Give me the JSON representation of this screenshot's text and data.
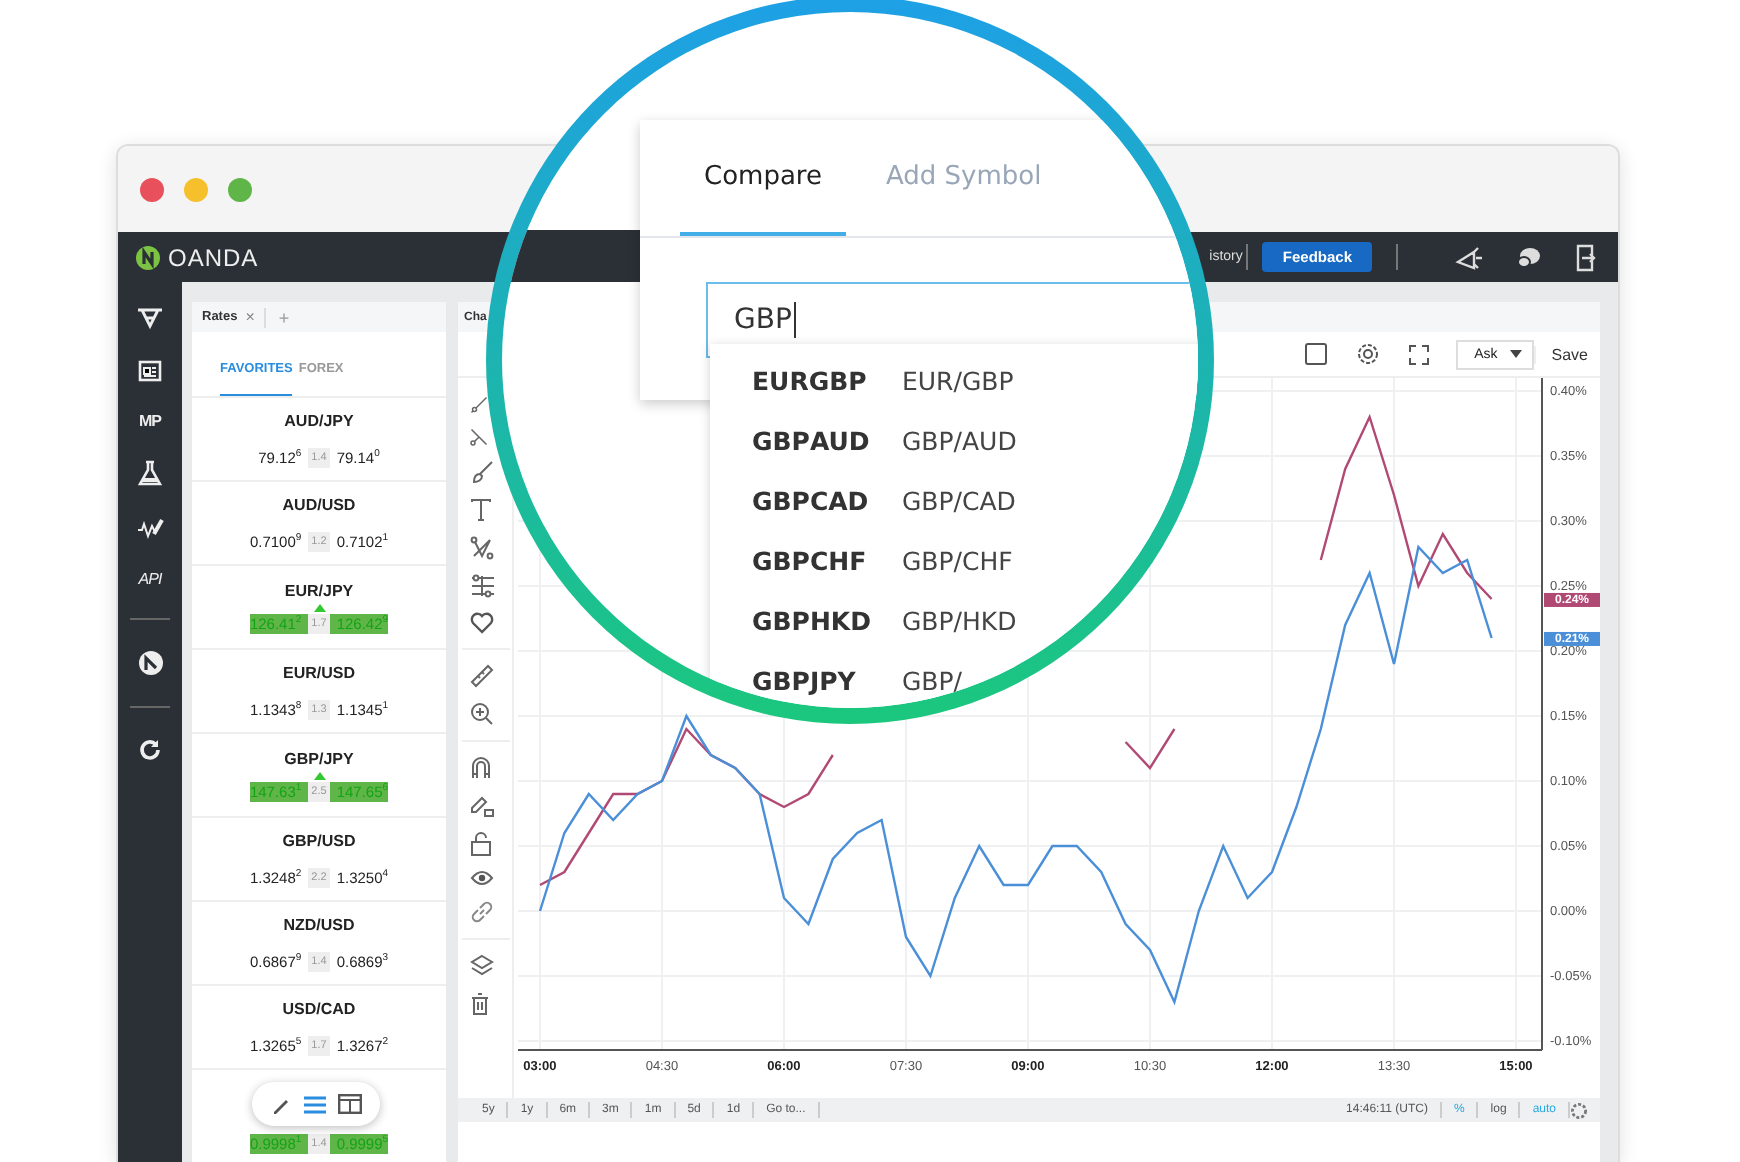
{
  "app_bar": {
    "logo": "OANDA",
    "link": "istory",
    "feedback": "Feedback"
  },
  "sidebar": {
    "labels": [
      "MP",
      "API"
    ]
  },
  "rates_panel": {
    "tab": "Rates",
    "close": "×",
    "add": "+",
    "filters": [
      {
        "label": "FAVORITES",
        "selected": true
      },
      {
        "label": "FOREX",
        "selected": false
      }
    ],
    "rows": [
      {
        "pair": "AUD/JPY",
        "up": false,
        "bid": "79.12$^{6}$",
        "spread": "1.4",
        "ask": "79.14$^{0}$"
      },
      {
        "pair": "AUD/USD",
        "up": false,
        "bid": "0.7100$^{9}$",
        "spread": "1.2",
        "ask": "0.7102$^{1}$"
      },
      {
        "pair": "EUR/JPY",
        "up": true,
        "bid": "126.41$^{2}$",
        "spread": "1.7",
        "ask": "126.42$^{9}$"
      },
      {
        "pair": "EUR/USD",
        "up": false,
        "bid": "1.1343$^{8}$",
        "spread": "1.3",
        "ask": "1.1345$^{1}$"
      },
      {
        "pair": "GBP/JPY",
        "up": true,
        "bid": "147.63$^{1}$",
        "spread": "2.5",
        "ask": "147.65$^{6}$"
      },
      {
        "pair": "GBP/USD",
        "up": false,
        "bid": "1.3248$^{2}$",
        "spread": "2.2",
        "ask": "1.3250$^{4}$"
      },
      {
        "pair": "NZD/USD",
        "up": false,
        "bid": "0.6867$^{9}$",
        "spread": "1.4",
        "ask": "0.6869$^{3}$"
      },
      {
        "pair": "USD/CAD",
        "up": false,
        "bid": "1.3265$^{5}$",
        "spread": "1.7",
        "ask": "1.3267$^{2}$"
      }
    ],
    "partial_row": {
      "up": true,
      "bid": "0.9998$^{1}$",
      "spread": "1.4",
      "ask": "0.9999$^{5}$"
    },
    "view_toolbar": [
      {
        "kind": "edit",
        "selected": false
      },
      {
        "kind": "list",
        "selected": true
      },
      {
        "kind": "panels",
        "selected": false
      }
    ]
  },
  "chart_panel": {
    "tab": "Cha",
    "price_side": "Ask",
    "save": "Save",
    "chart_data": {
      "type": "line",
      "x": [
        3.0,
        3.3,
        3.6,
        3.9,
        4.2,
        4.5,
        4.8,
        5.1,
        5.4,
        5.7,
        6.0,
        6.3,
        6.6,
        6.9,
        7.2,
        7.5,
        7.8,
        8.1,
        8.4,
        8.7,
        9.0,
        9.3,
        9.6,
        9.9,
        10.2,
        10.5,
        10.8,
        11.1,
        11.4,
        11.7,
        12.0,
        12.3,
        12.6,
        12.9,
        13.2,
        13.5,
        13.8,
        14.1,
        14.4,
        14.7
      ],
      "series": [
        {
          "color": "#b04a74",
          "values": [
            0.02,
            0.03,
            0.06,
            0.09,
            0.09,
            0.1,
            0.14,
            0.12,
            0.11,
            0.09,
            0.08,
            0.09,
            0.12,
            null,
            null,
            null,
            null,
            null,
            null,
            null,
            null,
            null,
            null,
            null,
            0.13,
            0.11,
            0.14,
            null,
            null,
            null,
            null,
            null,
            0.27,
            0.34,
            0.38,
            0.32,
            0.25,
            0.29,
            0.26,
            0.24
          ]
        },
        {
          "color": "#4a8fd8",
          "values": [
            0.0,
            0.06,
            0.09,
            0.07,
            0.09,
            0.1,
            0.15,
            0.12,
            0.11,
            0.09,
            0.01,
            -0.01,
            0.04,
            0.06,
            0.07,
            -0.02,
            -0.05,
            0.01,
            0.05,
            0.02,
            0.02,
            0.05,
            0.05,
            0.03,
            -0.01,
            -0.03,
            -0.07,
            0.0,
            0.05,
            0.01,
            0.03,
            0.08,
            0.14,
            0.22,
            0.26,
            0.19,
            0.28,
            0.26,
            0.27,
            0.21
          ]
        }
      ],
      "grid": true,
      "xlim": [
        2.73,
        15.32
      ],
      "ylim": [
        -0.107,
        0.41
      ],
      "xticks": [
        {
          "value": 3,
          "label": "03:00"
        },
        {
          "value": 4.5,
          "label": "04:30"
        },
        {
          "value": 6,
          "label": "06:00"
        },
        {
          "value": 7.5,
          "label": "07:30"
        },
        {
          "value": 9,
          "label": "09:00"
        },
        {
          "value": 10.5,
          "label": "10:30"
        },
        {
          "value": 12,
          "label": "12:00"
        },
        {
          "value": 13.5,
          "label": "13:30"
        },
        {
          "value": 15,
          "label": "15:00"
        }
      ],
      "yticks": [
        {
          "value": 0.4,
          "label": "0.40%"
        },
        {
          "value": 0.35,
          "label": "0.35%"
        },
        {
          "value": 0.3,
          "label": "0.30%"
        },
        {
          "value": 0.25,
          "label": "0.25%"
        },
        {
          "value": 0.2,
          "label": "0.20%"
        },
        {
          "value": 0.15,
          "label": "0.15%"
        },
        {
          "value": 0.1,
          "label": "0.10%"
        },
        {
          "value": 0.05,
          "label": "0.05%"
        },
        {
          "value": 0,
          "label": "0.00%"
        },
        {
          "value": -0.05,
          "label": "-0.05%"
        },
        {
          "value": -0.1,
          "label": "-0.10%"
        }
      ],
      "annotations": [
        "0.24%",
        "0.21%"
      ]
    },
    "ranges": [
      "5y",
      "1y",
      "6m",
      "3m",
      "1m",
      "5d",
      "1d",
      "Go to..."
    ],
    "clock": "14:46:11 (UTC)",
    "toggles": [
      {
        "label": "%",
        "on": true
      },
      {
        "label": "log",
        "on": false
      },
      {
        "label": "auto",
        "on": true
      }
    ]
  },
  "magnifier": {
    "tabs": [
      {
        "label": "Compare",
        "selected": true
      },
      {
        "label": "Add Symbol",
        "selected": false
      }
    ],
    "search": {
      "value": "GBP"
    },
    "results": [
      {
        "symbol": "EUR**GBP**",
        "name": "EUR/GBP"
      },
      {
        "symbol": "**GBP**AUD",
        "name": "GBP/AUD"
      },
      {
        "symbol": "**GBP**CAD",
        "name": "GBP/CAD"
      },
      {
        "symbol": "**GBP**CHF",
        "name": "GBP/CHF"
      },
      {
        "symbol": "**GBP**HKD",
        "name": "GBP/HKD"
      },
      {
        "symbol": "**GBP**JPY",
        "name": "GBP/"
      }
    ]
  }
}
